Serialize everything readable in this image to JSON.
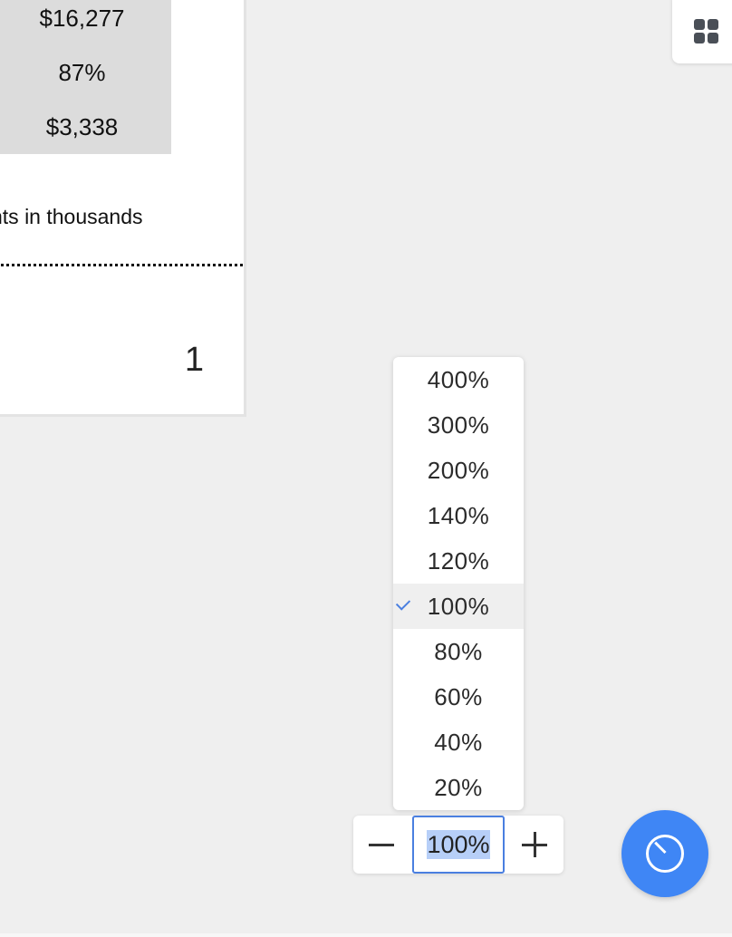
{
  "document": {
    "table_cells": [
      "$16,277",
      "87%",
      "$3,338"
    ],
    "note": "nts in thousands",
    "page_number": "1"
  },
  "apps_button": {
    "icon": "apps-grid-icon"
  },
  "zoom_menu": {
    "options": [
      "400%",
      "300%",
      "200%",
      "140%",
      "120%",
      "100%",
      "80%",
      "60%",
      "40%",
      "20%"
    ],
    "selected": "100%"
  },
  "zoom_control": {
    "value": "100%",
    "decrease_icon": "minus-icon",
    "increase_icon": "plus-icon"
  },
  "fab": {
    "icon": "timer-icon"
  },
  "colors": {
    "accent": "#3f86f5",
    "selection": "#b7cff8",
    "background": "#efefef"
  }
}
